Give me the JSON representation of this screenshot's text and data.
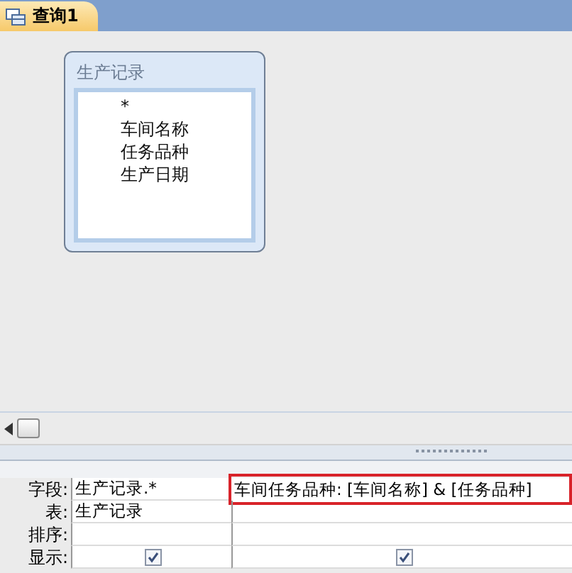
{
  "tab": {
    "title": "查询1",
    "selected": true
  },
  "table_box": {
    "title": "生产记录",
    "fields": [
      "*",
      "车间名称",
      "任务品种",
      "生产日期"
    ]
  },
  "grid": {
    "row_labels": [
      "字段:",
      "表:",
      "排序:",
      "显示:"
    ],
    "columns": [
      {
        "field": "生产记录.*",
        "table": "生产记录",
        "show": true,
        "highlighted": false
      },
      {
        "field": "车间任务品种: [车间名称] & [任务品种]",
        "show": true,
        "highlighted": true
      }
    ]
  }
}
